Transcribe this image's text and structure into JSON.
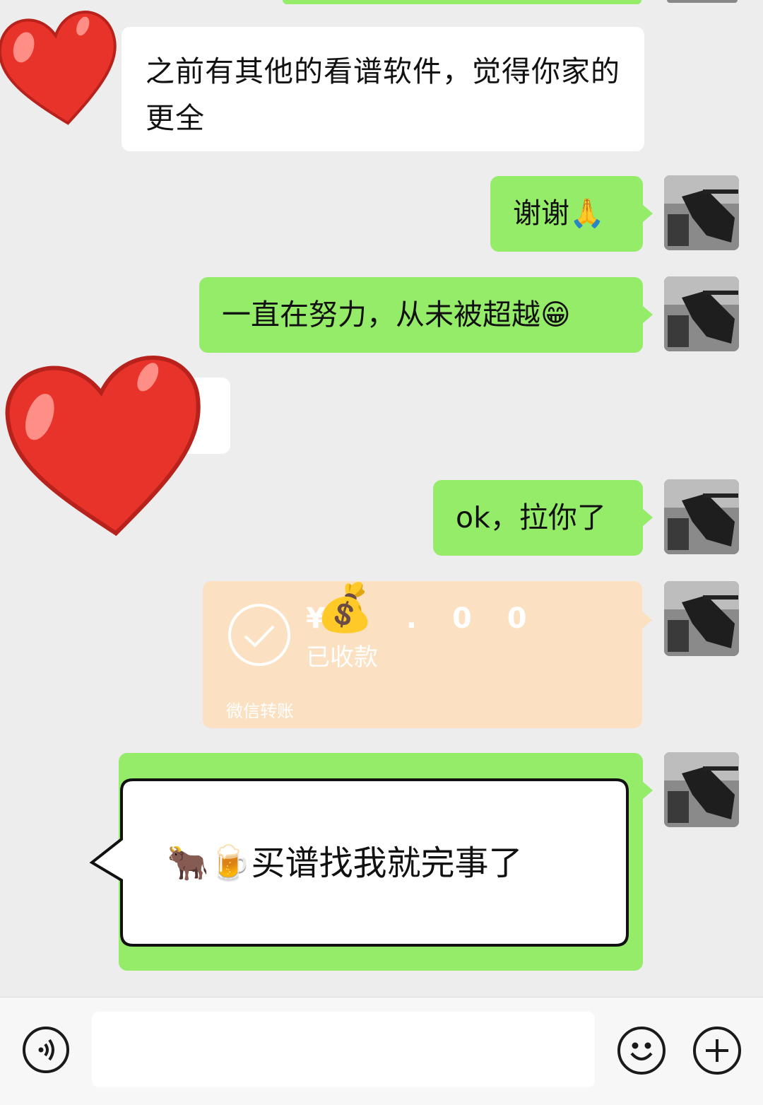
{
  "messages": {
    "incoming_1": "之前有其他的看谱软件，觉得你家的更全",
    "outgoing_1": "谢谢",
    "outgoing_2": "一直在努力，从未被超越",
    "outgoing_3": "ok，拉你了",
    "transfer": {
      "amount": "¥ .00",
      "status": "已收款",
      "footer": "微信转账"
    }
  },
  "overlay_callout": {
    "text": "买谱找我就完事了"
  },
  "icons": {
    "voice": "voice-icon",
    "emoji": "emoji-icon",
    "plus": "plus-icon"
  },
  "colors": {
    "chat_bg": "#ededed",
    "green_bubble": "#95ec69",
    "transfer_bg": "#fbe0c1",
    "heart": "#e8332b"
  }
}
